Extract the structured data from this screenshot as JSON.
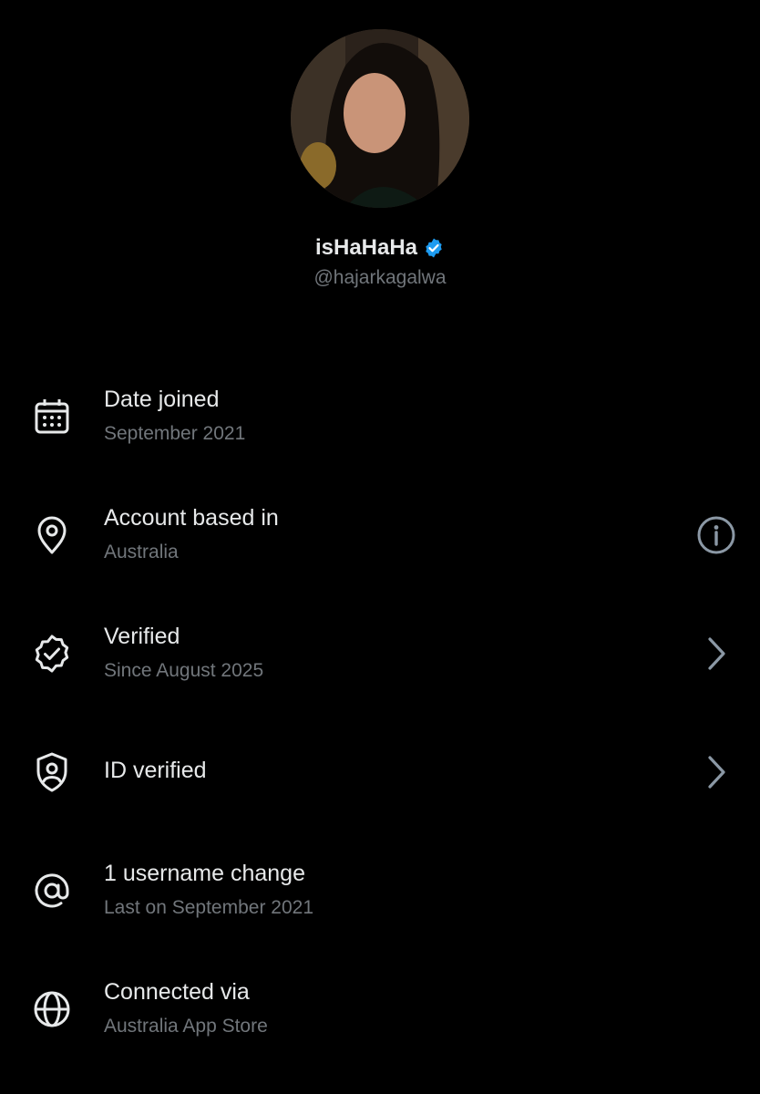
{
  "profile": {
    "display_name": "isHaHaHa",
    "handle": "@hajarkagalwa",
    "avatar_icon": "profile-photo",
    "verified_badge_color": "#1d9bf0"
  },
  "rows": [
    {
      "icon": "calendar-icon",
      "title": "Date joined",
      "subtitle": "September 2021"
    },
    {
      "icon": "location-pin-icon",
      "title": "Account based in",
      "subtitle": "Australia",
      "trailing": "info-icon"
    },
    {
      "icon": "verified-badge-icon",
      "title": "Verified",
      "subtitle": "Since August 2025",
      "trailing": "chevron-right-icon"
    },
    {
      "icon": "id-shield-icon",
      "title": "ID verified",
      "trailing": "chevron-right-icon"
    },
    {
      "icon": "at-sign-icon",
      "title": "1 username change",
      "subtitle": "Last on September 2021"
    },
    {
      "icon": "globe-icon",
      "title": "Connected via",
      "subtitle": "Australia App Store"
    }
  ]
}
